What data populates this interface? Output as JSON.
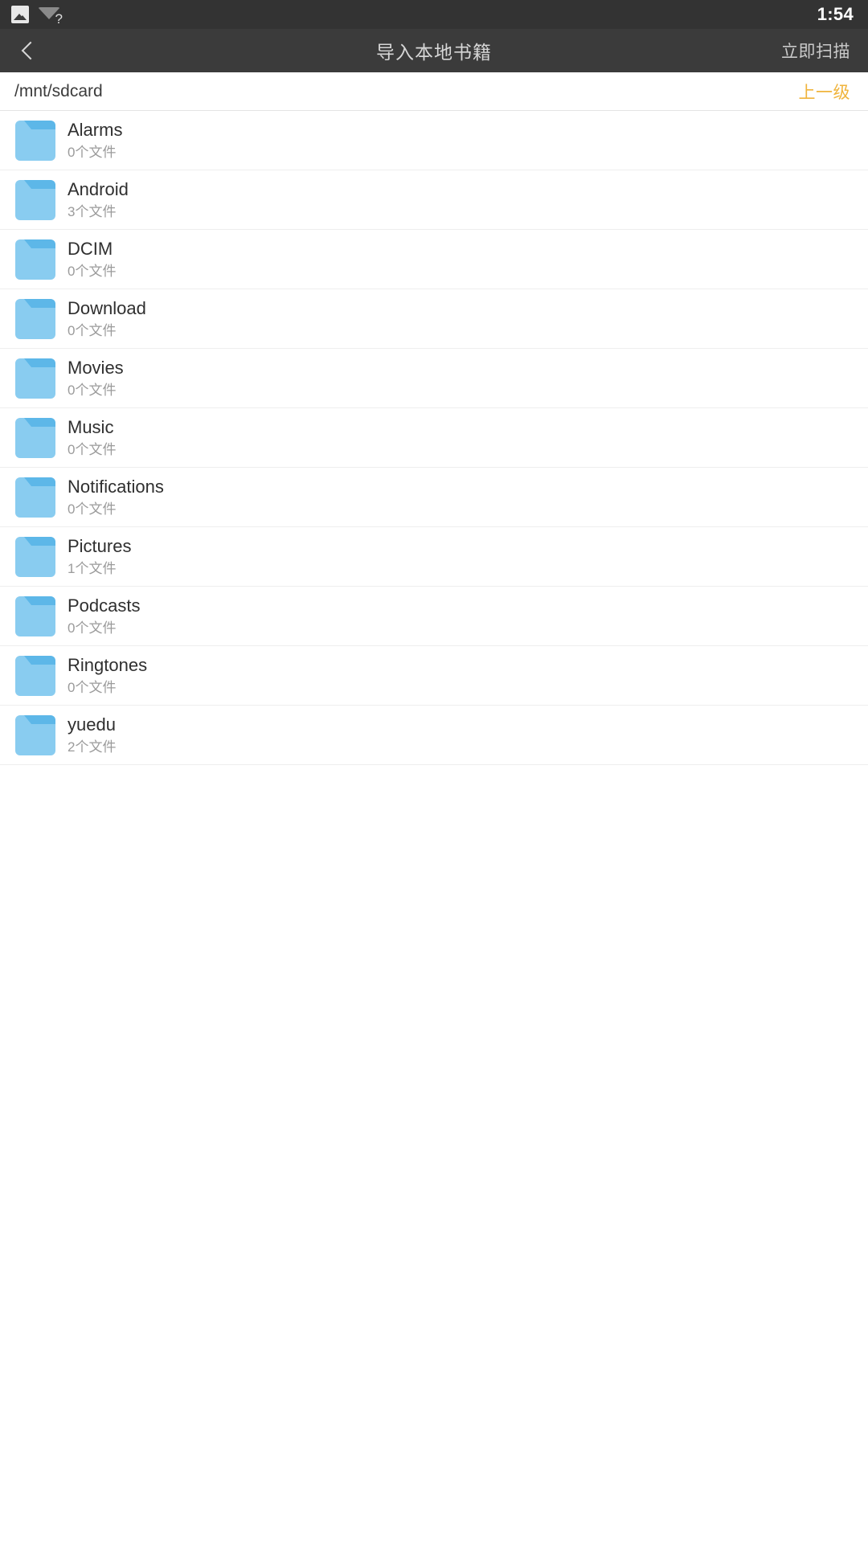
{
  "status_bar": {
    "icons": [
      {
        "name": "photo-icon",
        "glyph": "image"
      },
      {
        "name": "wifi-question-icon",
        "glyph": "wifi-unknown",
        "badge": "?"
      }
    ],
    "time": "1:54"
  },
  "toolbar": {
    "back_icon": "chevron-left-icon",
    "title": "导入本地书籍",
    "scan_label": "立即扫描",
    "background_color": "#3b3b3b",
    "title_color": "#d6d6d6"
  },
  "path_bar": {
    "path": "/mnt/sdcard",
    "up_level_label": "上一级",
    "up_level_color": "#f0b43c"
  },
  "file_list": {
    "folder_icon_color": "#89ccf0",
    "folder_tab_color": "#5db7e8",
    "items": [
      {
        "name": "Alarms",
        "count": "0个文件",
        "icon": "folder-icon"
      },
      {
        "name": "Android",
        "count": "3个文件",
        "icon": "folder-icon"
      },
      {
        "name": "DCIM",
        "count": "0个文件",
        "icon": "folder-icon"
      },
      {
        "name": "Download",
        "count": "0个文件",
        "icon": "folder-icon"
      },
      {
        "name": "Movies",
        "count": "0个文件",
        "icon": "folder-icon"
      },
      {
        "name": "Music",
        "count": "0个文件",
        "icon": "folder-icon"
      },
      {
        "name": "Notifications",
        "count": "0个文件",
        "icon": "folder-icon"
      },
      {
        "name": "Pictures",
        "count": "1个文件",
        "icon": "folder-icon"
      },
      {
        "name": "Podcasts",
        "count": "0个文件",
        "icon": "folder-icon"
      },
      {
        "name": "Ringtones",
        "count": "0个文件",
        "icon": "folder-icon"
      },
      {
        "name": "yuedu",
        "count": "2个文件",
        "icon": "folder-icon"
      }
    ]
  }
}
